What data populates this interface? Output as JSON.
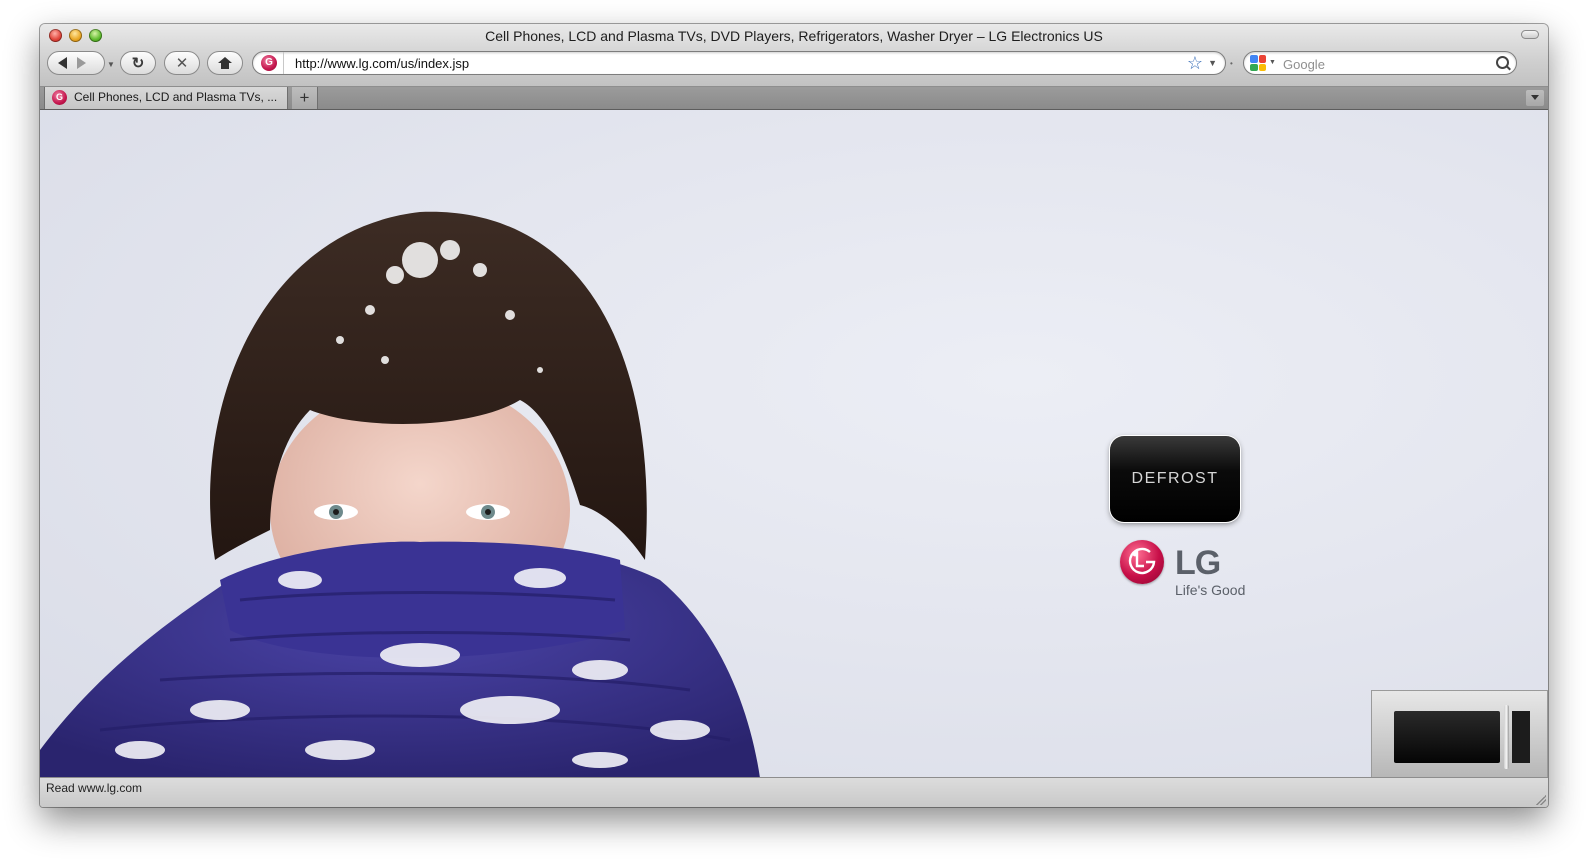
{
  "window": {
    "title": "Cell Phones, LCD and Plasma TVs, DVD Players, Refrigerators, Washer Dryer – LG Electronics US"
  },
  "toolbar": {
    "stop_glyph": "✕",
    "reload_glyph": "↻"
  },
  "address_bar": {
    "url": "http://www.lg.com/us/index.jsp",
    "site_icon_glyph": "G"
  },
  "search_bar": {
    "placeholder": "Google"
  },
  "tabs": [
    {
      "label": "Cell Phones, LCD and Plasma TVs, ...",
      "icon_glyph": "G"
    }
  ],
  "new_tab_glyph": "+",
  "page": {
    "defrost_label": "DEFROST",
    "brand": "LG",
    "tagline": "Life's Good"
  },
  "status_bar": {
    "text": "Read www.lg.com"
  },
  "colors": {
    "lg_red": "#c70f48",
    "scarf_purple": "#3b3590",
    "snow_background": "#e4e6ef"
  },
  "icons": [
    "back-icon",
    "forward-icon",
    "reload-icon",
    "stop-icon",
    "home-icon",
    "bookmark-star-icon",
    "google-icon",
    "search-icon",
    "tab-list-icon"
  ]
}
